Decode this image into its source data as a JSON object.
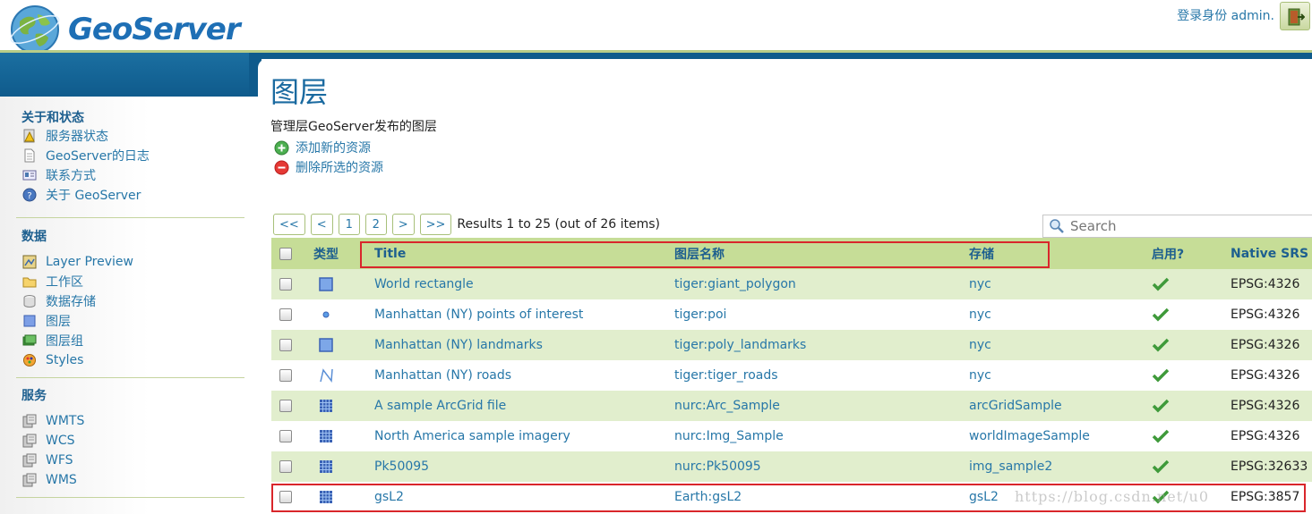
{
  "header": {
    "brand": "GeoServer",
    "login_text": "登录身份 admin."
  },
  "sidebar": {
    "sections": [
      {
        "title": "关于和状态",
        "items": [
          {
            "label": "服务器状态",
            "icon": "server-status-icon"
          },
          {
            "label": "GeoServer的日志",
            "icon": "log-icon"
          },
          {
            "label": "联系方式",
            "icon": "contact-icon"
          },
          {
            "label": "关于 GeoServer",
            "icon": "about-icon"
          }
        ]
      },
      {
        "title": "数据",
        "items": [
          {
            "label": "Layer Preview",
            "icon": "layer-preview-icon"
          },
          {
            "label": "工作区",
            "icon": "workspace-icon"
          },
          {
            "label": "数据存储",
            "icon": "datastore-icon"
          },
          {
            "label": "图层",
            "icon": "layer-icon"
          },
          {
            "label": "图层组",
            "icon": "layer-group-icon"
          },
          {
            "label": "Styles",
            "icon": "styles-icon"
          }
        ]
      },
      {
        "title": "服务",
        "items": [
          {
            "label": "WMTS",
            "icon": "service-icon"
          },
          {
            "label": "WCS",
            "icon": "service-icon"
          },
          {
            "label": "WFS",
            "icon": "service-icon"
          },
          {
            "label": "WMS",
            "icon": "service-icon"
          }
        ]
      }
    ]
  },
  "main": {
    "title": "图层",
    "description": "管理层GeoServer发布的图层",
    "add_link": "添加新的资源",
    "remove_link": "删除所选的资源"
  },
  "pager": {
    "first": "<<",
    "prev": "<",
    "page1": "1",
    "page2": "2",
    "next": ">",
    "last": ">>",
    "results": "Results 1 to 25 (out of 26 items)"
  },
  "search": {
    "placeholder": "Search"
  },
  "table": {
    "headers": {
      "type": "类型",
      "title": "Title",
      "name": "图层名称",
      "store": "存储",
      "enabled": "启用?",
      "srs": "Native SRS"
    },
    "rows": [
      {
        "type": "polygon",
        "title": "World rectangle",
        "name": "tiger:giant_polygon",
        "store": "nyc",
        "srs": "EPSG:4326"
      },
      {
        "type": "point",
        "title": "Manhattan (NY) points of interest",
        "name": "tiger:poi",
        "store": "nyc",
        "srs": "EPSG:4326"
      },
      {
        "type": "polygon",
        "title": "Manhattan (NY) landmarks",
        "name": "tiger:poly_landmarks",
        "store": "nyc",
        "srs": "EPSG:4326"
      },
      {
        "type": "line",
        "title": "Manhattan (NY) roads",
        "name": "tiger:tiger_roads",
        "store": "nyc",
        "srs": "EPSG:4326"
      },
      {
        "type": "raster",
        "title": "A sample ArcGrid file",
        "name": "nurc:Arc_Sample",
        "store": "arcGridSample",
        "srs": "EPSG:4326"
      },
      {
        "type": "raster",
        "title": "North America sample imagery",
        "name": "nurc:Img_Sample",
        "store": "worldImageSample",
        "srs": "EPSG:4326"
      },
      {
        "type": "raster",
        "title": "Pk50095",
        "name": "nurc:Pk50095",
        "store": "img_sample2",
        "srs": "EPSG:32633"
      },
      {
        "type": "raster",
        "title": "gsL2",
        "name": "Earth:gsL2",
        "store": "gsL2",
        "srs": "EPSG:3857"
      }
    ]
  },
  "watermark": "https://blog.csdn.net/u0",
  "colors": {
    "brand_blue": "#1e6fb5",
    "band_blue": "#0f5b8c",
    "header_green": "#c6dd97",
    "row_green": "#e1eecd",
    "highlight_red": "#d9262b",
    "check_green": "#3f9a3a"
  }
}
